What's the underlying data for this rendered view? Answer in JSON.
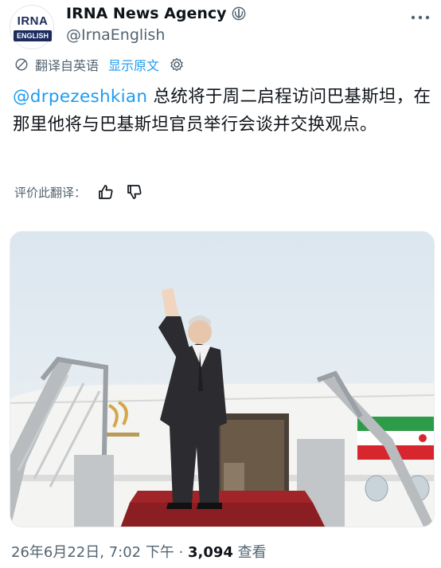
{
  "header": {
    "display_name": "IRNA News Agency",
    "handle": "@IrnaEnglish",
    "avatar_top": "IRNA",
    "avatar_bottom": "ENGLISH"
  },
  "translation": {
    "translated_label": "翻译自英语",
    "show_original": "显示原文"
  },
  "tweet": {
    "mention": "@drpezeshkian",
    "body": " 总统将于周二启程访问巴基斯坦，在那里他将与巴基斯坦官员举行会谈并交换观点。"
  },
  "rating": {
    "label": "评价此翻译："
  },
  "meta": {
    "timestamp": "26年6月22日, 7:02 下午 · ",
    "views_count": "3,094",
    "views_label": " 查看"
  },
  "colors": {
    "link": "#1d9bf0",
    "secondary": "#536471",
    "text": "#0f1419"
  }
}
